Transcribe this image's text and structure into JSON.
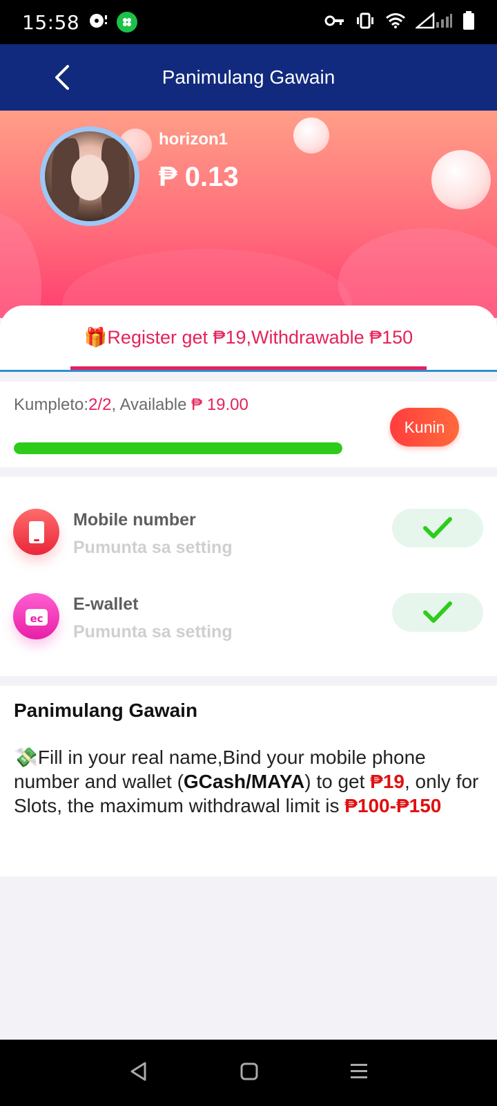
{
  "status_bar": {
    "time": "15:58"
  },
  "header": {
    "title": "Panimulang Gawain"
  },
  "profile": {
    "username": "horizon1",
    "balance": "₱ 0.13"
  },
  "tab": {
    "label": "🎁Register get ₱19,Withdrawable ₱150"
  },
  "progress": {
    "prefix": "Kumpleto:",
    "completed": "2/2",
    "middle": ", Available ",
    "available": "₱ 19.00",
    "fraction": 1.0,
    "claim_label": "Kunin"
  },
  "tasks": [
    {
      "title": "Mobile number",
      "subtitle": "Pumunta sa setting",
      "icon": "phone-icon",
      "done": true
    },
    {
      "title": "E-wallet",
      "subtitle": "Pumunta sa setting",
      "icon": "wallet-icon",
      "done": true
    }
  ],
  "description": {
    "title": "Panimulang Gawain",
    "p1": "💸Fill in your real name,Bind your mobile phone number and wallet (",
    "b1": "GCash/MAYA",
    "p2": ") to get ",
    "r1": "₱19",
    "p3": ", only for Slots, the maximum withdrawal limit is ",
    "r2": "₱100-₱150"
  },
  "colors": {
    "header_bg": "#112a7d",
    "accent": "#e5215a",
    "progress": "#2ecc1a",
    "check": "#2ecc1a"
  }
}
